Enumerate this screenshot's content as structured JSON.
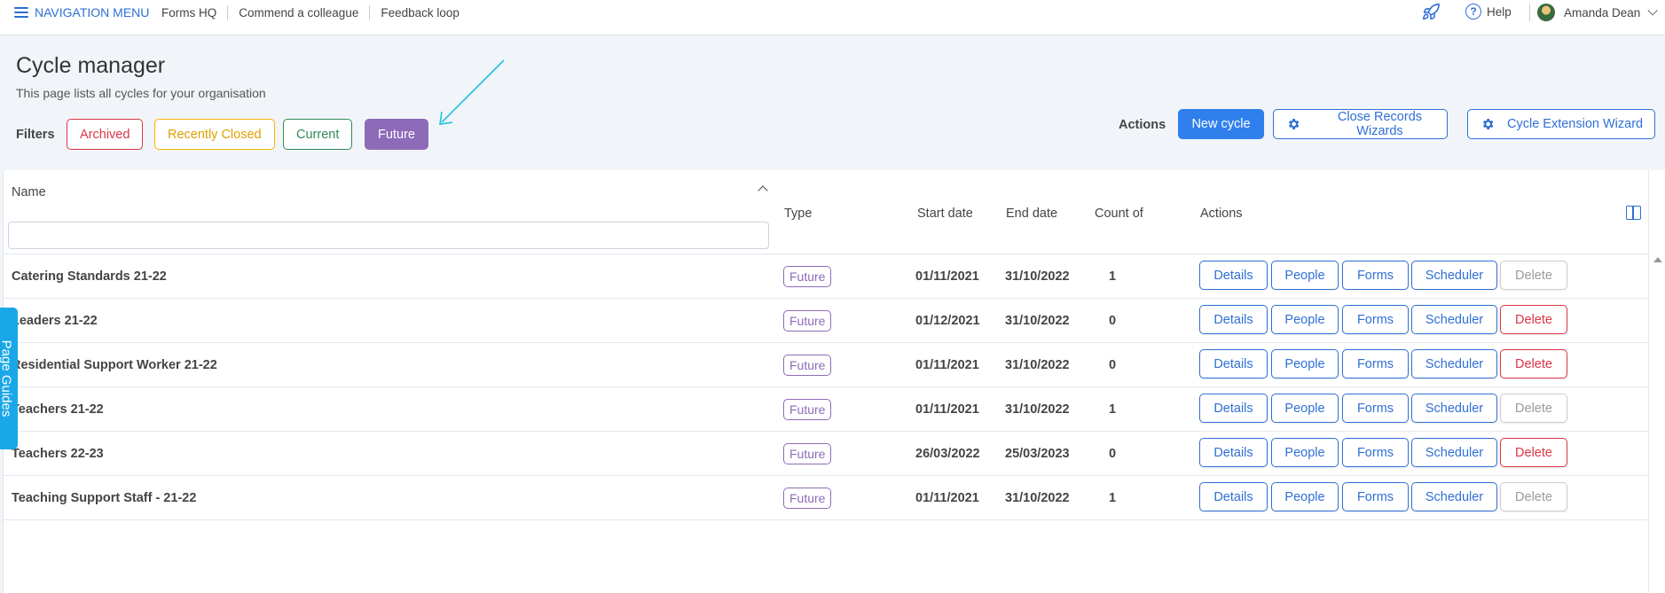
{
  "topbar": {
    "nav_menu": "NAVIGATION MENU",
    "links": [
      "Forms HQ",
      "Commend a colleague",
      "Feedback loop"
    ],
    "help": "Help",
    "user_name": "Amanda Dean"
  },
  "page": {
    "title": "Cycle manager",
    "subtitle": "This page lists all cycles for your organisation"
  },
  "filters": {
    "label": "Filters",
    "items": [
      "Archived",
      "Recently Closed",
      "Current",
      "Future"
    ],
    "active": "Future"
  },
  "actions": {
    "label": "Actions",
    "new_cycle": "New cycle",
    "close_records": "Close Records Wizards",
    "cycle_extension": "Cycle Extension Wizard"
  },
  "table": {
    "columns": {
      "name": "Name",
      "type": "Type",
      "start": "Start date",
      "end": "End date",
      "count": "Count of",
      "actions": "Actions"
    },
    "name_filter_value": "",
    "row_buttons": [
      "Details",
      "People",
      "Forms",
      "Scheduler",
      "Delete"
    ],
    "rows": [
      {
        "name": "Catering Standards 21-22",
        "type": "Future",
        "start": "01/11/2021",
        "end": "31/10/2022",
        "count": "1",
        "delete_enabled": false
      },
      {
        "name": "Leaders 21-22",
        "type": "Future",
        "start": "01/12/2021",
        "end": "31/10/2022",
        "count": "0",
        "delete_enabled": true
      },
      {
        "name": "Residential Support Worker 21-22",
        "type": "Future",
        "start": "01/11/2021",
        "end": "31/10/2022",
        "count": "0",
        "delete_enabled": true
      },
      {
        "name": "Teachers 21-22",
        "type": "Future",
        "start": "01/11/2021",
        "end": "31/10/2022",
        "count": "1",
        "delete_enabled": false
      },
      {
        "name": "Teachers 22-23",
        "type": "Future",
        "start": "26/03/2022",
        "end": "25/03/2023",
        "count": "0",
        "delete_enabled": true
      },
      {
        "name": "Teaching Support Staff - 21-22",
        "type": "Future",
        "start": "01/11/2021",
        "end": "31/10/2022",
        "count": "1",
        "delete_enabled": false
      }
    ]
  },
  "page_guides": "Page Guides",
  "colors": {
    "primary": "#2f6fd6",
    "future": "#8e6bb8",
    "danger": "#dc3545",
    "warning": "#f5b400",
    "success": "#2e8b57",
    "guides": "#1aa7e8"
  }
}
